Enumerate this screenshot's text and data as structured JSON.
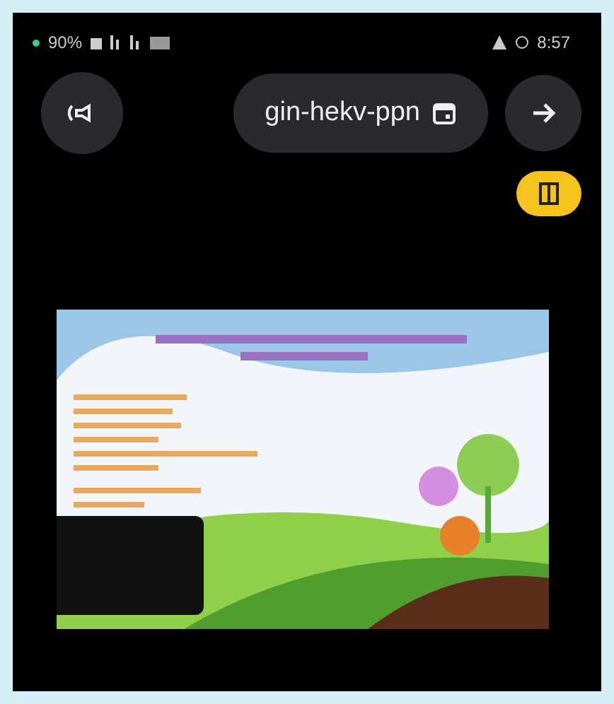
{
  "status_bar": {
    "battery": "90%",
    "time": "8:57"
  },
  "meeting": {
    "code": "gin-hekv-ppn"
  },
  "shared_screen": {
    "kind": "slide"
  }
}
